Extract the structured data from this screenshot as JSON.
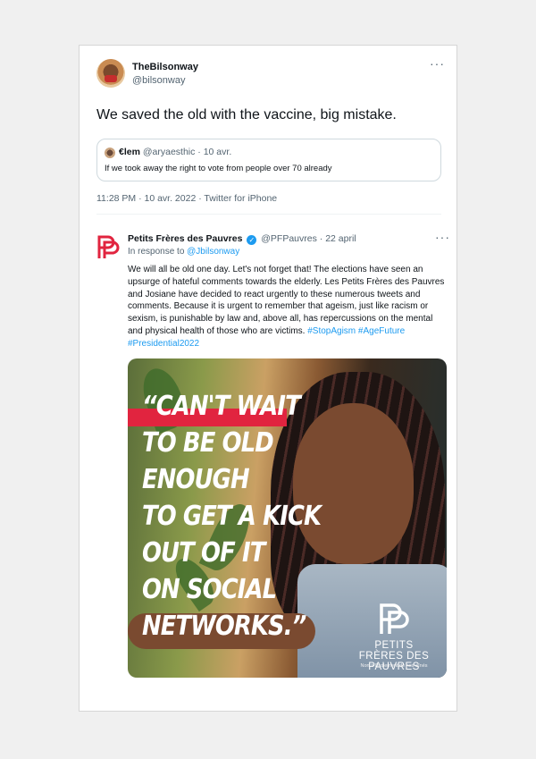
{
  "tweet": {
    "name": "TheBilsonway",
    "handle": "@bilsonway",
    "text": "We saved the old with the vaccine, big mistake.",
    "more": "···",
    "meta": "11:28 PM · 10 avr. 2022 · Twitter for iPhone",
    "quote": {
      "name": "€lem",
      "handle": "@aryaesthic",
      "date": "· 10 avr.",
      "text": "If we took away the right to vote from people over 70 already"
    }
  },
  "reply": {
    "name": "Petits Frères des Pauvres",
    "verified_glyph": "✓",
    "handle": "@PFPauvres",
    "date": "· 22 april",
    "more": "···",
    "in_response_prefix": "In response to ",
    "in_response_handle": "@Jbilsonway",
    "text": "We will all be old one day. Let's not forget that! The elections have seen an upsurge of hateful comments towards the elderly. Les Petits Frères des Pauvres and Josiane have decided to react urgently to these numerous tweets and comments. Because it is urgent to remember that ageism, just like racism or sexism, is punishable by law and, above all, has repercussions on the mental and physical health of those who are victims.",
    "hashtags": "#StopAgism #AgeFuture #Presidential2022"
  },
  "poster": {
    "slogan": "“CAN'T WAIT\nTO BE OLD\nENOUGH\nTO GET A KICK\nOUT OF IT\nON SOCIAL\nNETWORKS.”",
    "brand_name": "PETITS FRÈRES DES PAUVRES",
    "brand_sub": "Non à l'isolement de nos aînés"
  },
  "colors": {
    "brand_red": "#e1243f",
    "link_blue": "#1d9bf0"
  }
}
